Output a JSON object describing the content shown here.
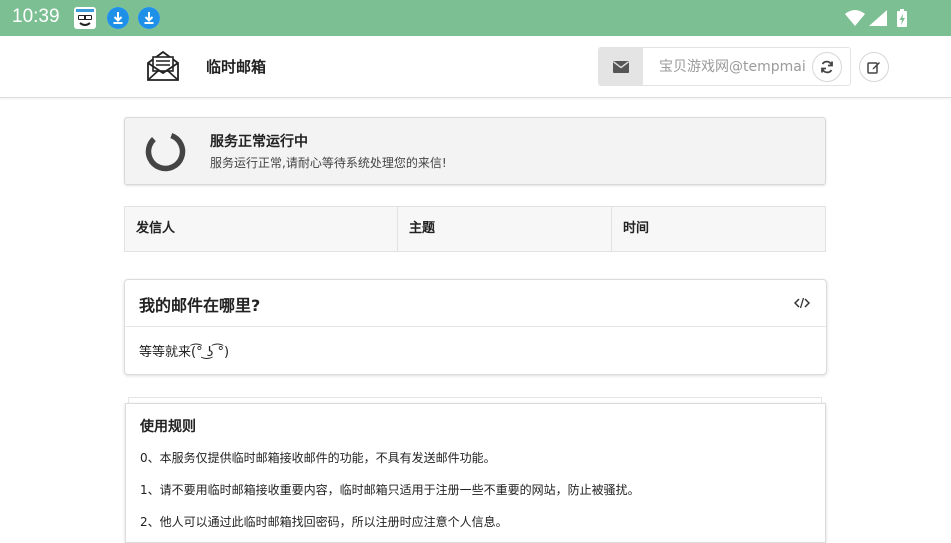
{
  "status_bar": {
    "time": "10:39",
    "notif_icons": [
      "game-icon",
      "download-icon",
      "download-icon"
    ],
    "system_icons": [
      "wifi-icon",
      "signal-icon",
      "battery-icon"
    ]
  },
  "header": {
    "title": "临时邮箱",
    "email_placeholder": "宝贝游戏网@tempmai",
    "icons": {
      "logo": "envelope-open-icon",
      "addon": "envelope-icon",
      "refresh": "refresh-icon",
      "edit": "edit-icon"
    }
  },
  "status": {
    "title": "服务正常运行中",
    "subtitle": "服务运行正常,请耐心等待系统处理您的来信!"
  },
  "table": {
    "columns": [
      "发信人",
      "主题",
      "时间"
    ]
  },
  "card": {
    "title": "我的邮件在哪里?",
    "body": "等等就来(͡° ͜ʖ ͡°)",
    "icon": "code-icon"
  },
  "rules": {
    "title": "使用规则",
    "items": [
      "0、本服务仅提供临时邮箱接收邮件的功能，不具有发送邮件功能。",
      "1、请不要用临时邮箱接收重要内容，临时邮箱只适用于注册一些不重要的网站，防止被骚扰。",
      "2、他人可以通过此临时邮箱找回密码，所以注册时应注意个人信息。"
    ]
  },
  "colors": {
    "status_bar": "#7bbf93",
    "download_icon": "#2196f3"
  }
}
